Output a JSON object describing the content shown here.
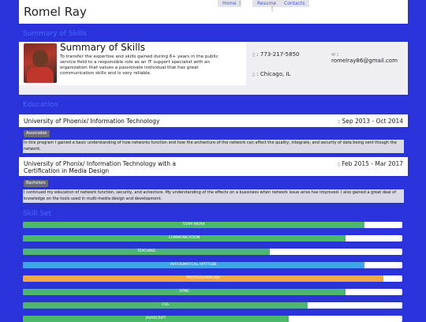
{
  "header": {
    "name": "Romel Ray",
    "nav": [
      "Home",
      "Resume",
      "Contacts"
    ]
  },
  "summary": {
    "section_title": "Summary of Skills",
    "heading": "Summary of Skills",
    "text": "To transfer the expertise and skills gained during 6+ years in the public service field to a responsible role as an IT support specialist with an organization that values a passionate individual that has great communication skills and is very reliable.",
    "phone": ": 773-217-5850",
    "email_prefix": ":",
    "email": "romelray86@gmail.com",
    "location": ": Chicago, IL"
  },
  "education": {
    "section_title": "Education",
    "items": [
      {
        "title": "University of Phoenix/ Information Technology",
        "date": "Sep 2013 - Oct 2014",
        "badge": "Associates",
        "desc": "In this program I gained a basic understanding of how networks function and how the archecture of the network can affect the quality, integrate, and security of data being sent though the network."
      },
      {
        "title": "University of Phonix/ Information Technology with a Certification in Media Design",
        "date": "Feb 2015 - Mar 2017",
        "badge": "Bachelors",
        "desc": "I continued my education of network function, security, and achecture. My understanding of the effects on a bussiness when network issue arise has improved. I also gained a great deal of knowledge on the tools used in multi-media design and development."
      }
    ]
  },
  "skills": {
    "section_title": "Skill Set",
    "items": [
      {
        "label": "TEAM WORK",
        "level": 0.9,
        "color": "#4cb86b"
      },
      {
        "label": "COMMUNICATION",
        "level": 0.85,
        "color": "#4cb86b"
      },
      {
        "label": "TEACHING",
        "level": 0.65,
        "color": "#4cb86b"
      },
      {
        "label": "MATHEMATICAL APTITUDE",
        "level": 0.9,
        "color": "#3fa6e6"
      },
      {
        "label": "PROFESSIONALISM",
        "level": 0.95,
        "color": "#f0a84a"
      },
      {
        "label": "HTML",
        "level": 0.85,
        "color": "#4cb86b"
      },
      {
        "label": "CSS",
        "level": 0.75,
        "color": "#4cb86b"
      },
      {
        "label": "JAVASCRIPT",
        "level": 0.7,
        "color": "#4cb86b"
      }
    ]
  }
}
